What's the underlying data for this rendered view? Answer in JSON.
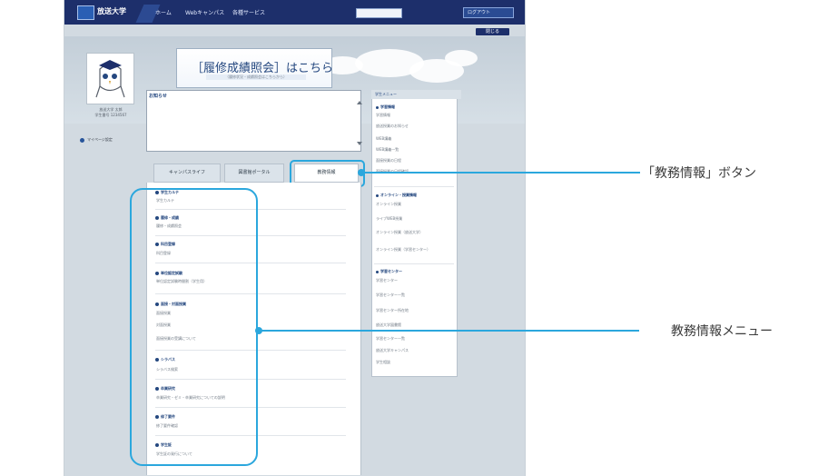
{
  "header": {
    "logo_text": "放送大学",
    "nav": [
      "ホーム",
      "Webキャンパス",
      "各種サービス"
    ],
    "search_value": "",
    "right_button": "ログアウト",
    "sub_button": "閉じる"
  },
  "profile": {
    "name": "放送大学 太郎",
    "student_id": "学生番号 1234567",
    "link": "マイページ設定"
  },
  "banner": {
    "title": "［履修成績照会］はこちら",
    "subtitle": "（履修状況・成績照会はこちらから）"
  },
  "message": {
    "title": "お知らせ"
  },
  "tabs": [
    {
      "label": "キャンパスライフ"
    },
    {
      "label": "図書館ポータル"
    },
    {
      "label": "教務情報"
    }
  ],
  "menu": [
    {
      "title": "学生カルテ",
      "items": [
        "学生カルテ"
      ]
    },
    {
      "title": "履修・成績",
      "items": [
        "履修・成績照会"
      ]
    },
    {
      "title": "科目登録",
      "items": [
        "科目登録"
      ]
    },
    {
      "title": "単位認定試験",
      "items": [
        "単位認定試験時間割（学生用）"
      ]
    },
    {
      "title": "面接・対面授業",
      "items": [
        "面接授業",
        "対面授業",
        "面接授業の受講について"
      ]
    },
    {
      "title": "シラバス",
      "items": [
        "シラバス検索"
      ]
    },
    {
      "title": "卒業研究",
      "items": [
        "卒業研究・ゼミ・卒業研究についての説明"
      ]
    },
    {
      "title": "修了要件",
      "items": [
        "修了要件確認"
      ]
    },
    {
      "title": "学生証",
      "items": [
        "学生証の発行について"
      ]
    }
  ],
  "sidebar": {
    "header": "学生メニュー",
    "groups": [
      {
        "title": "学習情報",
        "items": [
          "学習情報",
          "放送授業のお知らせ",
          "WEB講義",
          "WEB講義一覧",
          "面接授業の日程",
          "面接授業の日程確認"
        ]
      },
      {
        "title": "オンライン・授業情報",
        "items": [
          "オンライン授業",
          "ライブWEB授業",
          "オンライン授業（放送大学）",
          "オンライン授業（学習センター）"
        ]
      },
      {
        "title": "学習センター",
        "items": [
          "学習センター",
          "学習センター一覧",
          "学習センター所在地",
          "放送大学図書館",
          "学習センター一覧",
          "放送大学キャンパス",
          "学生相談"
        ]
      }
    ]
  },
  "callouts": {
    "button": "「教務情報」ボタン",
    "menu": "教務情報メニュー"
  }
}
